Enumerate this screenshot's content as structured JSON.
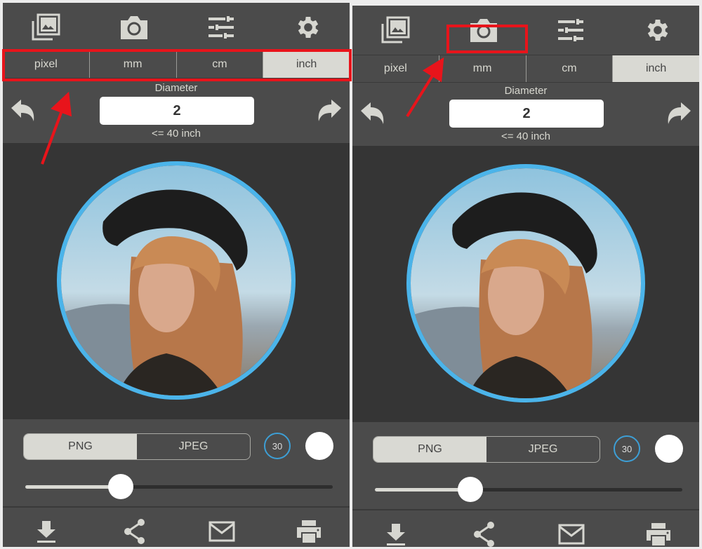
{
  "colors": {
    "panel_bg": "#4b4b4b",
    "canvas_bg": "#353535",
    "accent_blue": "#4bb4ea",
    "annotation_red": "#e8141b"
  },
  "panels": [
    {
      "toolbar": {
        "icons": [
          "gallery-icon",
          "camera-icon",
          "sliders-icon",
          "gear-icon"
        ]
      },
      "units": [
        "pixel",
        "mm",
        "cm",
        "inch"
      ],
      "active_unit": "inch",
      "diameter": {
        "label": "Diameter",
        "value": "2",
        "hint": "<= 40 inch"
      },
      "format": {
        "options": [
          "PNG",
          "JPEG"
        ],
        "selected": "PNG"
      },
      "quality": "30",
      "slider_value": 0.31,
      "bottom_icons": [
        "download-icon",
        "share-icon",
        "mail-icon",
        "print-icon"
      ],
      "highlight": "units-row"
    },
    {
      "toolbar": {
        "icons": [
          "gallery-icon",
          "camera-icon",
          "sliders-icon",
          "gear-icon"
        ]
      },
      "units": [
        "pixel",
        "mm",
        "cm",
        "inch"
      ],
      "active_unit": "inch",
      "diameter": {
        "label": "Diameter",
        "value": "2",
        "hint": "<= 40 inch"
      },
      "format": {
        "options": [
          "PNG",
          "JPEG"
        ],
        "selected": "PNG"
      },
      "quality": "30",
      "slider_value": 0.31,
      "bottom_icons": [
        "download-icon",
        "share-icon",
        "mail-icon",
        "print-icon"
      ],
      "highlight": "camera-button"
    }
  ]
}
